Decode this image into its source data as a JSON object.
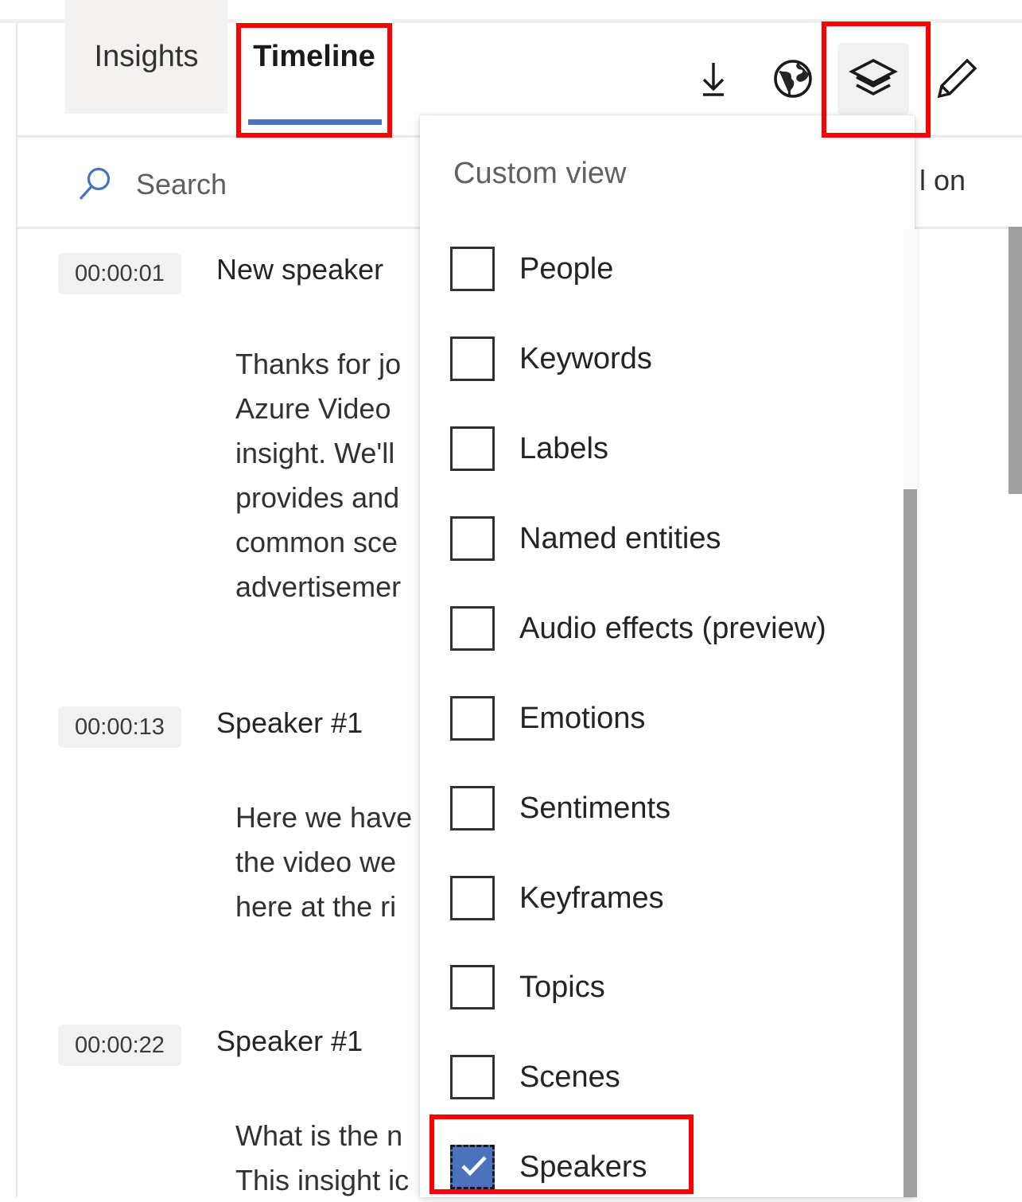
{
  "tabs": [
    {
      "label": "Insights",
      "active": false
    },
    {
      "label": "Timeline",
      "active": true
    }
  ],
  "toolbar": {
    "download": {
      "name": "download-icon",
      "tooltip": "Download"
    },
    "translate": {
      "name": "globe-icon",
      "tooltip": "Translate"
    },
    "layers": {
      "name": "layers-icon",
      "tooltip": "View",
      "active": true
    },
    "edit": {
      "name": "pencil-icon",
      "tooltip": "Edit"
    }
  },
  "search": {
    "icon": "search-icon",
    "placeholder": "Search",
    "value": ""
  },
  "right_partial_text": "l on",
  "transcript": [
    {
      "time": "00:00:01",
      "speaker": "New speaker",
      "text": "Thanks for jo\nAzure Video\ninsight. We'll\nprovides and\ncommon sce\nadvertisemer"
    },
    {
      "time": "00:00:13",
      "speaker": "Speaker #1",
      "text": "Here we have\nthe video we\nhere at the ri"
    },
    {
      "time": "00:00:22",
      "speaker": "Speaker #1",
      "text": "What is the n\nThis insight ic"
    }
  ],
  "dropdown": {
    "title": "Custom view",
    "items": [
      {
        "label": "People",
        "checked": false
      },
      {
        "label": "Keywords",
        "checked": false
      },
      {
        "label": "Labels",
        "checked": false
      },
      {
        "label": "Named entities",
        "checked": false
      },
      {
        "label": "Audio effects (preview)",
        "checked": false
      },
      {
        "label": "Emotions",
        "checked": false
      },
      {
        "label": "Sentiments",
        "checked": false
      },
      {
        "label": "Keyframes",
        "checked": false
      },
      {
        "label": "Topics",
        "checked": false
      },
      {
        "label": "Scenes",
        "checked": false
      },
      {
        "label": "Speakers",
        "checked": true
      }
    ]
  },
  "colors": {
    "accent_blue": "#4a72bd",
    "search_icon_blue": "#4a72bd",
    "annotation_red": "#ff0000",
    "checkbox_checked": "#4a72bd",
    "tab_inactive_bg": "#f3f2f1",
    "scrollbar_thumb": "#a0a0a0"
  }
}
